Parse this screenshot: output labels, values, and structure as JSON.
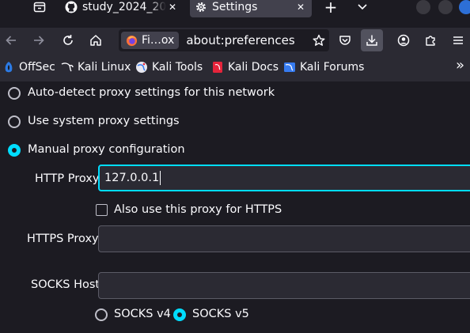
{
  "tabs": [
    {
      "title": "study_2024_20",
      "close": "✕",
      "icon": "github-icon",
      "active": false
    },
    {
      "title": "Settings",
      "close": "✕",
      "icon": "gear-icon",
      "active": true
    }
  ],
  "tabstrip": {
    "new_tab": "+",
    "list_all_tabs": "⌄"
  },
  "urlbar": {
    "identity_label": "Fi…ox",
    "url": "about:preferences"
  },
  "bookmarks": [
    {
      "label": "OffSec",
      "icon": "offsec-icon"
    },
    {
      "label": "Kali Linux",
      "icon": "kali-dragon-icon"
    },
    {
      "label": "Kali Tools",
      "icon": "kali-tools-icon"
    },
    {
      "label": "Kali Docs",
      "icon": "kali-docs-icon"
    },
    {
      "label": "Kali Forums",
      "icon": "kali-forums-icon"
    }
  ],
  "bookmarks_overflow": "»",
  "proxy": {
    "auto_detect": "Auto-detect proxy settings for this network",
    "system": "Use system proxy settings",
    "manual": "Manual proxy configuration",
    "selected": "manual",
    "http_label": "HTTP Proxy",
    "http_value": "127.0.0.1",
    "also_https_label": "Also use this proxy for HTTPS",
    "also_https_checked": false,
    "https_label": "HTTPS Proxy",
    "https_value": "",
    "socks_label": "SOCKS Host",
    "socks_value": "",
    "socks_v4": "SOCKS v4",
    "socks_v5": "SOCKS v5",
    "socks_selected": "v5"
  },
  "colors": {
    "accent": "#00ddff",
    "background": "#1c1b22",
    "toolbar": "#2b2a33",
    "text": "#fbfbfe"
  }
}
